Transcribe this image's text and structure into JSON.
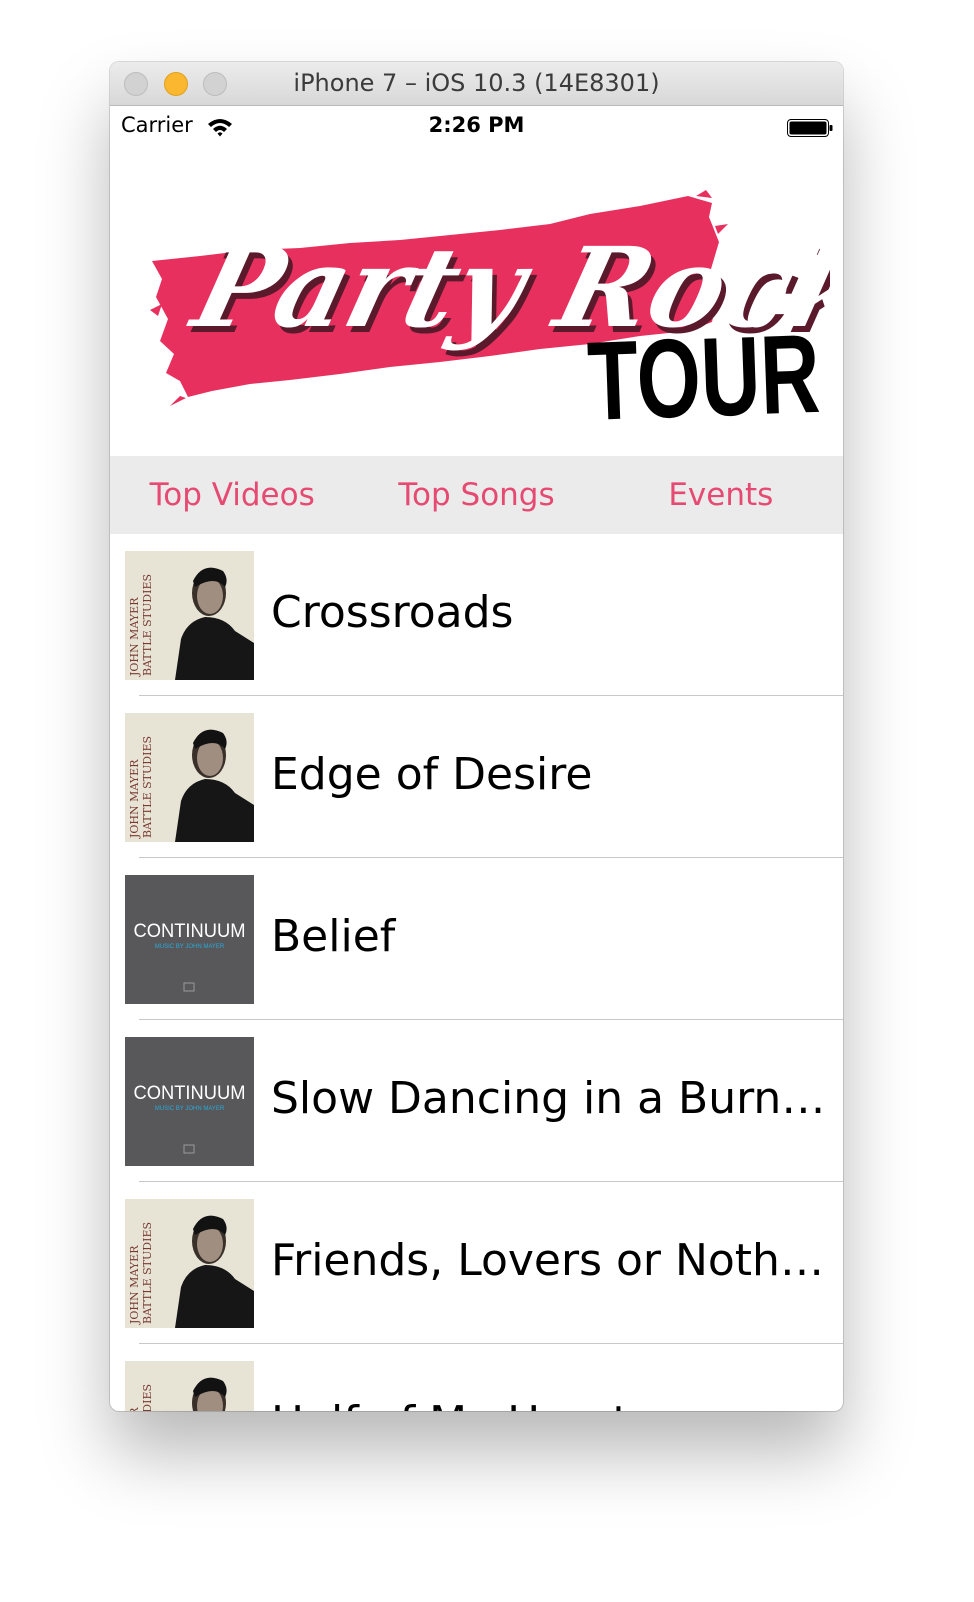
{
  "window": {
    "title": "iPhone 7 – iOS 10.3 (14E8301)"
  },
  "status_bar": {
    "carrier": "Carrier",
    "time": "2:26 PM",
    "wifi_icon": "wifi-icon",
    "battery_icon": "battery-icon"
  },
  "banner": {
    "logo_script": "Party Rock",
    "logo_word": "TOUR"
  },
  "tabs": [
    {
      "label": "Top Videos"
    },
    {
      "label": "Top Songs"
    },
    {
      "label": "Events"
    }
  ],
  "songs": [
    {
      "title": "Crossroads",
      "album_art": "battle-studies"
    },
    {
      "title": "Edge of Desire",
      "album_art": "battle-studies"
    },
    {
      "title": "Belief",
      "album_art": "continuum"
    },
    {
      "title": "Slow Dancing in a Burni…",
      "album_art": "continuum"
    },
    {
      "title": "Friends, Lovers or Nothing",
      "album_art": "battle-studies"
    },
    {
      "title": "Half of My Heart",
      "album_art": "battle-studies"
    }
  ],
  "album_art": {
    "battle-studies": {
      "side_text_1": "JOHN MAYER",
      "side_text_2": "BATTLE STUDIES"
    },
    "continuum": {
      "title": "CONTINUUM",
      "subtitle": "MUSIC BY JOHN MAYER"
    }
  },
  "colors": {
    "accent": "#e64971",
    "logo_red": "#e8305f",
    "tab_bar_bg": "#ebebeb",
    "separator": "#c8c8cc",
    "continuum_bg": "#58585b"
  }
}
